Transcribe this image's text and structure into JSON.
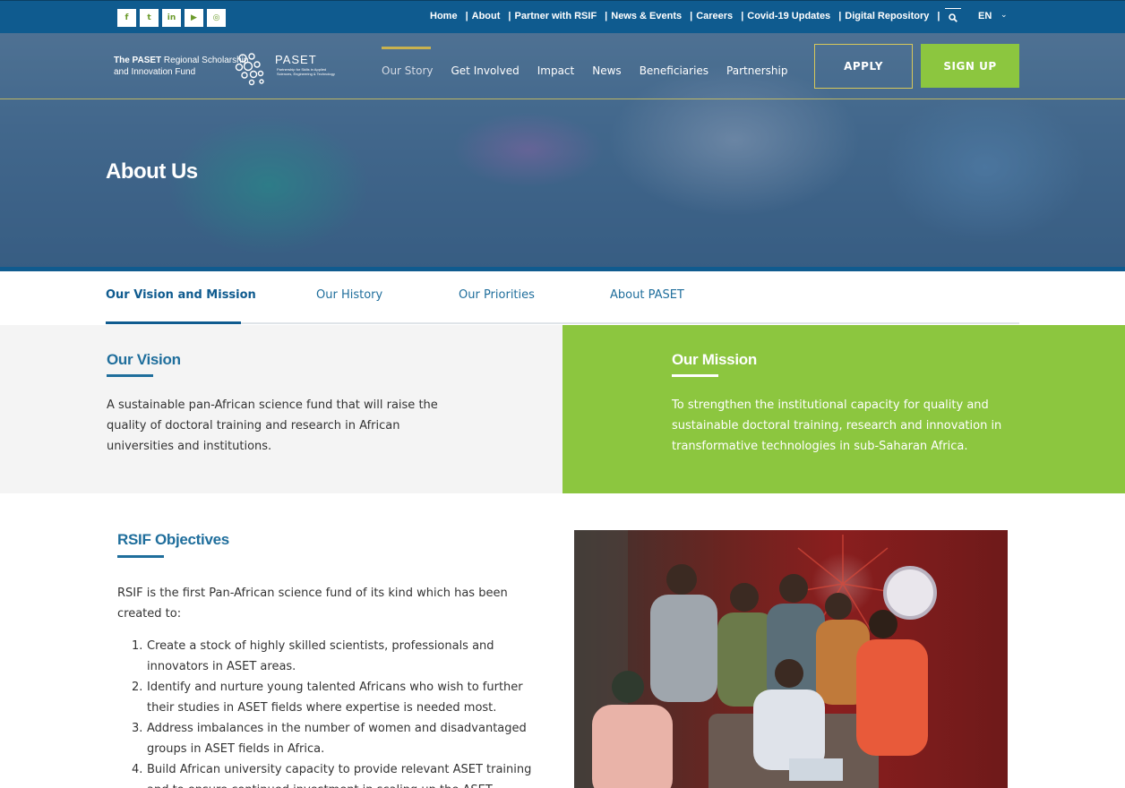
{
  "topbar": {
    "social": [
      {
        "name": "facebook-icon",
        "glyph": "f"
      },
      {
        "name": "twitter-icon",
        "glyph": "t"
      },
      {
        "name": "linkedin-icon",
        "glyph": "in"
      },
      {
        "name": "youtube-icon",
        "glyph": "▶"
      },
      {
        "name": "instagram-icon",
        "glyph": "◎"
      }
    ],
    "links": [
      "Home",
      "About",
      "Partner with RSIF",
      "News & Events",
      "Careers",
      "Covid-19 Updates",
      "Digital Repository"
    ],
    "language": "EN"
  },
  "logo": {
    "line1_bold": "The PASET",
    "line1_rest": " Regional Scholarship",
    "line2": "and Innovation Fund",
    "paset": "PASET",
    "paset_tagline": "Partnership for Skills in Applied Sciences, Engineering & Technology"
  },
  "nav": {
    "items": [
      "Our Story",
      "Get Involved",
      "Impact",
      "News",
      "Beneficiaries",
      "Partnership"
    ],
    "apply": "APPLY",
    "signup": "SIGN UP"
  },
  "hero": {
    "title": "About Us"
  },
  "tabs": [
    "Our Vision and Mission",
    "Our History",
    "Our Priorities",
    "About PASET"
  ],
  "vision": {
    "title": "Our Vision",
    "text": "A sustainable pan-African science fund that will raise the quality of doctoral training and research in African universities and institutions."
  },
  "mission": {
    "title": "Our Mission",
    "text": "To strengthen the institutional capacity for quality and sustainable doctoral training, research and innovation in transformative technologies in sub-Saharan Africa."
  },
  "objectives": {
    "title": "RSIF Objectives",
    "intro": "RSIF is the first Pan-African science fund of its kind which has been created to:",
    "items": [
      "Create a stock of highly skilled scientists, professionals and innovators in ASET areas.",
      "Identify and nurture young talented Africans who wish to further their studies in ASET fields where expertise is needed most.",
      "Address imbalances in the number of women and disadvantaged groups in ASET fields in Africa.",
      "Build African university capacity to provide relevant ASET training and to ensure continued investment in scaling up the ASET"
    ]
  },
  "colors": {
    "brand_blue": "#0f5b8f",
    "brand_green": "#8cc63f",
    "accent_gold": "#c9b24f"
  }
}
